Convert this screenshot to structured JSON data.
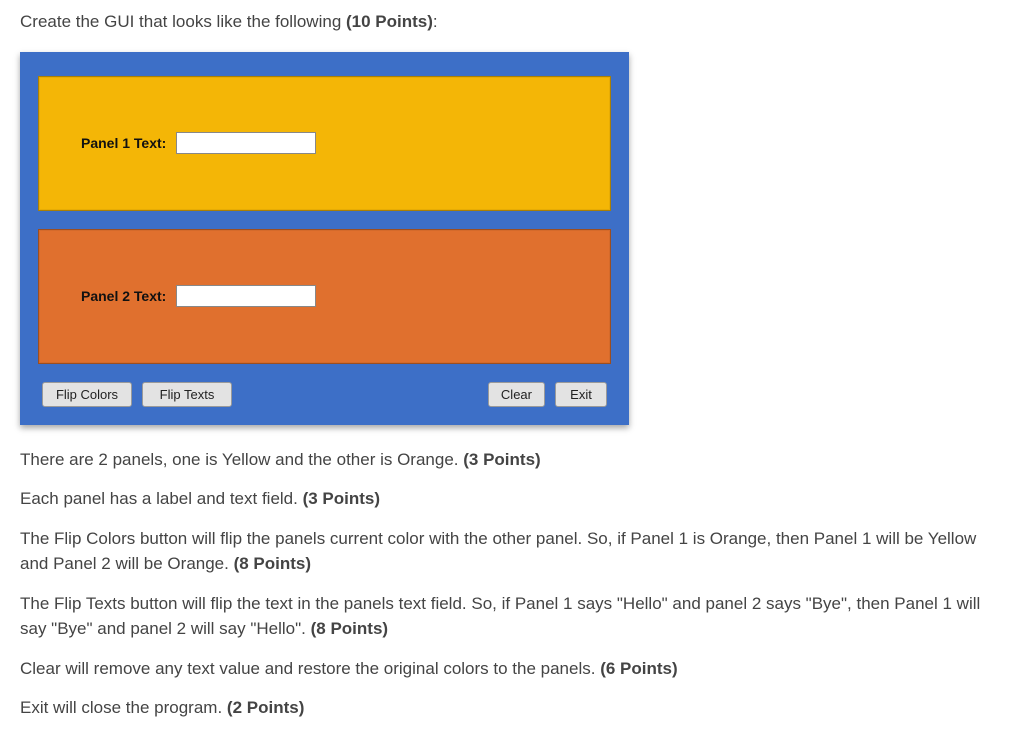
{
  "prompt": {
    "text_before": "Create the GUI that looks like the following ",
    "points": "(10 Points)",
    "text_after": ":"
  },
  "gui": {
    "panel1": {
      "label": "Panel 1 Text:",
      "value": ""
    },
    "panel2": {
      "label": "Panel 2 Text:",
      "value": ""
    },
    "buttons": {
      "flip_colors": "Flip Colors",
      "flip_texts": "Flip Texts",
      "clear": "Clear",
      "exit": "Exit"
    }
  },
  "descriptions": [
    {
      "text": "There are 2 panels, one is Yellow and the other is Orange. ",
      "points": "(3 Points)"
    },
    {
      "text": "Each panel has a label and text field. ",
      "points": "(3 Points)"
    },
    {
      "text": "The Flip Colors button will flip the panels current color with the other panel.  So, if Panel 1 is Orange, then Panel 1 will be Yellow and Panel 2 will be Orange. ",
      "points": "(8 Points)"
    },
    {
      "text": "The Flip Texts button will flip the text in the panels text field.  So, if Panel 1 says \"Hello\" and panel 2 says \"Bye\", then Panel 1 will say \"Bye\" and panel 2 will say \"Hello\". ",
      "points": "(8 Points)"
    },
    {
      "text": "Clear will remove any text value and restore the original colors to the panels. ",
      "points": "(6 Points)"
    },
    {
      "text": "Exit will close the program. ",
      "points": "(2 Points)"
    }
  ]
}
